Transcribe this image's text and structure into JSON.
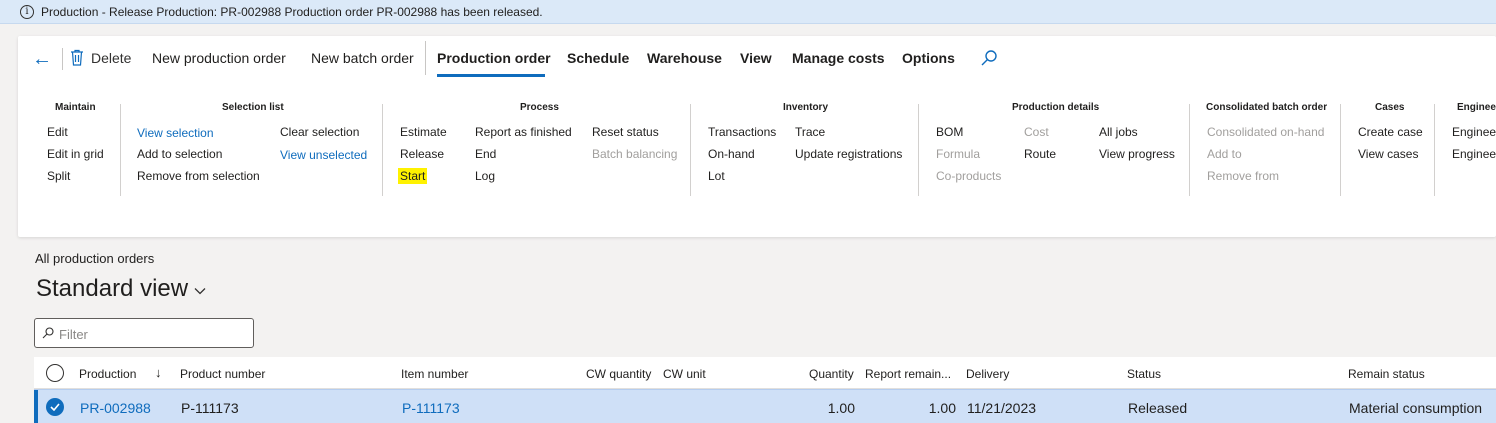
{
  "message_bar": {
    "icon": "info-icon",
    "text": "Production - Release   Production: PR-002988 Production order PR-002988 has been released."
  },
  "toolbar": {
    "delete_label": "Delete",
    "tabs": [
      "New production order",
      "New batch order",
      "Production order",
      "Schedule",
      "Warehouse",
      "View",
      "Manage costs",
      "Options"
    ],
    "active_tab": "Production order"
  },
  "ribbon": {
    "maintain": {
      "header": "Maintain",
      "items": [
        "Edit",
        "Edit in grid",
        "Split"
      ]
    },
    "selection_list": {
      "header": "Selection list",
      "items": [
        "View selection",
        "Add to selection",
        "Remove from selection",
        "Clear selection",
        "View unselected"
      ]
    },
    "process": {
      "header": "Process",
      "items": [
        "Estimate",
        "Release",
        "Start",
        "Report as finished",
        "End",
        "Log",
        "Reset status",
        "Batch balancing"
      ]
    },
    "inventory": {
      "header": "Inventory",
      "items": [
        "Transactions",
        "On-hand",
        "Lot",
        "Trace",
        "Update registrations"
      ]
    },
    "production_details": {
      "header": "Production details",
      "items": [
        "BOM",
        "Formula",
        "Co-products",
        "Cost",
        "Route",
        "All jobs",
        "View progress"
      ]
    },
    "consolidated": {
      "header": "Consolidated batch order",
      "items": [
        "Consolidated on-hand",
        "Add to",
        "Remove from"
      ]
    },
    "cases": {
      "header": "Cases",
      "items": [
        "Create case",
        "View cases"
      ]
    },
    "engineering": {
      "header": "Engineer",
      "items": [
        "Engineer",
        "Engineer"
      ]
    }
  },
  "list": {
    "caption": "All production orders",
    "view_name": "Standard view",
    "filter_placeholder": "Filter"
  },
  "grid": {
    "columns": [
      "Production",
      "Product number",
      "Item number",
      "CW quantity",
      "CW unit",
      "Quantity",
      "Report remain...",
      "Delivery",
      "Status",
      "Remain status"
    ],
    "rows": [
      {
        "production": "PR-002988",
        "product_number": "P-111173",
        "item_number": "P-111173",
        "cw_quantity": "",
        "cw_unit": "",
        "quantity": "1.00",
        "report_remain": "1.00",
        "delivery": "11/21/2023",
        "status": "Released",
        "remain_status": "Material consumption"
      }
    ]
  },
  "colors": {
    "accent": "#0f6cbd",
    "highlight": "#fff200",
    "selected_row": "#cfe0f7"
  }
}
